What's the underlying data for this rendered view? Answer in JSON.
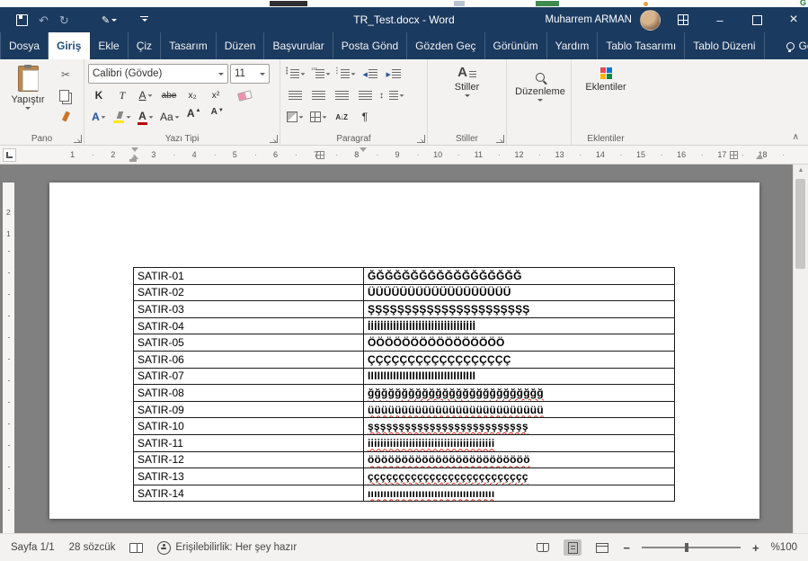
{
  "background_strip": {
    "fragment_text": "G"
  },
  "title_bar": {
    "document_title": "TR_Test.docx  -  Word",
    "user_name": "Muharrem ARMAN"
  },
  "tabs": [
    {
      "label": "Dosya",
      "active": false
    },
    {
      "label": "Giriş",
      "active": true
    },
    {
      "label": "Ekle",
      "active": false
    },
    {
      "label": "Çiz",
      "active": false
    },
    {
      "label": "Tasarım",
      "active": false
    },
    {
      "label": "Düzen",
      "active": false
    },
    {
      "label": "Başvurular",
      "active": false
    },
    {
      "label": "Posta Gönd",
      "active": false
    },
    {
      "label": "Gözden Geç",
      "active": false
    },
    {
      "label": "Görünüm",
      "active": false
    },
    {
      "label": "Yardım",
      "active": false
    },
    {
      "label": "Tablo Tasarımı",
      "active": false
    },
    {
      "label": "Tablo Düzeni",
      "active": false
    }
  ],
  "show_button": {
    "label": "Göster"
  },
  "ribbon": {
    "pano": {
      "label": "Pano",
      "paste": "Yapıştır"
    },
    "font": {
      "label": "Yazı Tipi",
      "family": "Calibri (Gövde)",
      "size": "11",
      "bold": "K",
      "italic": "T",
      "underline": "A",
      "strike": "abe",
      "sub": "x₂",
      "sup": "x²",
      "fx": "A",
      "color": "A",
      "case": "Aa",
      "grow": "A",
      "shrink": "A"
    },
    "paragraf": {
      "label": "Paragraf",
      "pilcrow": "¶",
      "sort": "A↓Z"
    },
    "stiller": {
      "label": "Stiller",
      "button": "Stiller"
    },
    "duzenleme": {
      "label": "Düzenleme"
    },
    "eklentiler": {
      "label": "Eklentiler",
      "button": "Eklentiler"
    }
  },
  "ruler": {
    "numbers": [
      "1",
      "2",
      "3",
      "4",
      "5",
      "6",
      "7",
      "8",
      "9",
      "10",
      "11",
      "12",
      "13",
      "14",
      "15",
      "16",
      "17",
      "18"
    ],
    "vertical_numbers": [
      "2",
      "1"
    ]
  },
  "table": {
    "rows": [
      {
        "label": "SATIR-01",
        "value": "ĞĞĞĞĞĞĞĞĞĞĞĞĞĞĞĞĞĞ",
        "misspelled": false
      },
      {
        "label": "SATIR-02",
        "value": "ÜÜÜÜÜÜÜÜÜÜÜÜÜÜÜÜÜÜ",
        "misspelled": false
      },
      {
        "label": "SATIR-03",
        "value": "ŞŞŞŞŞŞŞŞŞŞŞŞŞŞŞŞŞŞŞŞŞŞ",
        "misspelled": false
      },
      {
        "label": "SATIR-04",
        "value": "İİİİİİİİİİİİİİİİİİİİİİİİİİİİİİİİİİ",
        "misspelled": false
      },
      {
        "label": "SATIR-05",
        "value": "ÖÖÖÖÖÖÖÖÖÖÖÖÖÖÖÖ",
        "misspelled": false
      },
      {
        "label": "SATIR-06",
        "value": "ÇÇÇÇÇÇÇÇÇÇÇÇÇÇÇÇÇÇ",
        "misspelled": false
      },
      {
        "label": "SATIR-07",
        "value": "IIIIIIIIIIIIIIIIIIIIIIIIIIIIIIIIII",
        "misspelled": false
      },
      {
        "label": "SATIR-08",
        "value": "ğğğğğğğğğğğğğğğğğğğğğğğğğğ",
        "misspelled": true
      },
      {
        "label": "SATIR-09",
        "value": "üüüüüüüüüüüüüüüüüüüüüüüüüü",
        "misspelled": true
      },
      {
        "label": "SATIR-10",
        "value": "şşşşşşşşşşşşşşşşşşşşşşşşşş",
        "misspelled": true
      },
      {
        "label": "SATIR-11",
        "value": "iiiiiiiiiiiiiiiiiiiiiiiiiiiiiiiiiiiiiiii",
        "misspelled": true
      },
      {
        "label": "SATIR-12",
        "value": "öööööööööööööööööööööööö",
        "misspelled": true
      },
      {
        "label": "SATIR-13",
        "value": "çççççççççççççççççççççççççç",
        "misspelled": true
      },
      {
        "label": "SATIR-14",
        "value": "ıııııııııııııııııııııııııııııııııııııııı",
        "misspelled": true
      }
    ]
  },
  "status_bar": {
    "page": "Sayfa 1/1",
    "words": "28 sözcük",
    "accessibility": "Erişilebilirlik: Her şey hazır",
    "zoom": "%100"
  },
  "colors": {
    "title_bar": "#1b3a5f",
    "active_tab_text": "#1f4e79",
    "ribbon_bg": "#f3f2f1",
    "document_bg": "#808080",
    "squiggly_red": "#e02b20",
    "highlight_yellow": "#ffe913",
    "font_color_red": "#c00000"
  }
}
